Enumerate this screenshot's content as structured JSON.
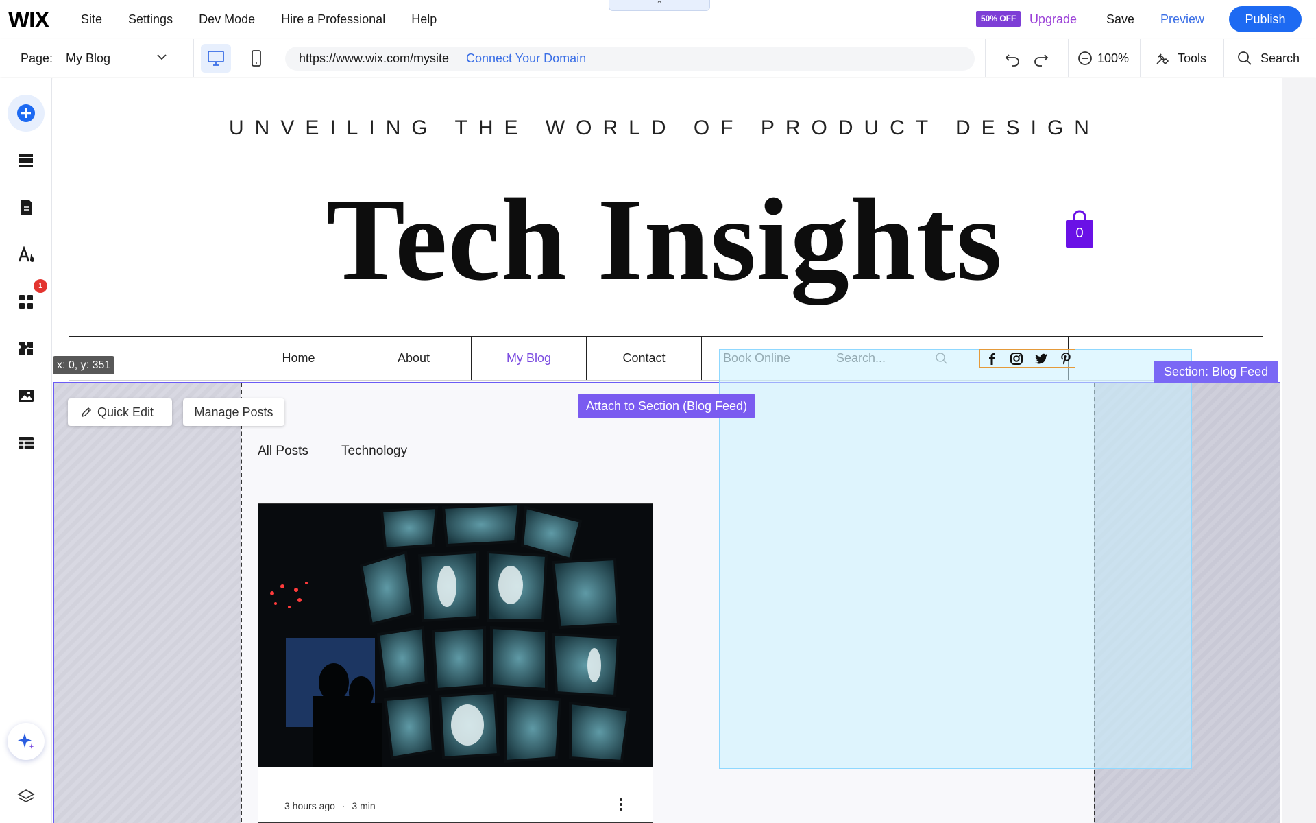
{
  "app": {
    "logo": "WIX",
    "menu": [
      "Site",
      "Settings",
      "Dev Mode",
      "Hire a Professional",
      "Help"
    ],
    "handle_glyph": "⌃",
    "discount_badge": "50% OFF",
    "upgrade": "Upgrade",
    "save": "Save",
    "preview": "Preview",
    "publish": "Publish",
    "accent_color": "#1d6af2"
  },
  "toolbar": {
    "page_label": "Page:",
    "page_value": "My Blog",
    "url": "https://www.wix.com/mysite",
    "connect_domain": "Connect Your Domain",
    "zoom": "100%",
    "tools": "Tools",
    "search": "Search"
  },
  "rail": {
    "icons": [
      "add-icon",
      "sections-icon",
      "pages-icon",
      "design-icon",
      "apps-icon",
      "business-icon",
      "media-icon",
      "cms-icon"
    ],
    "apps_notification": "1"
  },
  "site": {
    "tagline": "UNVEILING THE WORLD OF PRODUCT DESIGN",
    "title": "Tech Insights",
    "cart_count": "0",
    "nav": [
      {
        "label": "Home"
      },
      {
        "label": "About"
      },
      {
        "label": "My Blog"
      },
      {
        "label": "Contact"
      },
      {
        "label": "Book Online"
      }
    ],
    "search_placeholder": "Search...",
    "social": [
      "facebook-icon",
      "instagram-icon",
      "twitter-icon",
      "pinterest-icon"
    ]
  },
  "editor": {
    "coords": "x: 0, y: 351",
    "section_tag": "Section: Blog Feed",
    "quick_edit": "Quick Edit",
    "manage_posts": "Manage Posts",
    "attach": "Attach to Section (Blog Feed)",
    "section_color": "#6b5cf5"
  },
  "blog": {
    "tabs": [
      "All Posts",
      "Technology"
    ],
    "post": {
      "time": "3 hours ago",
      "separator": "·",
      "read_time": "3 min"
    }
  }
}
